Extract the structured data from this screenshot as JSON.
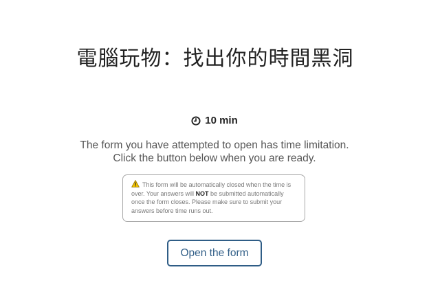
{
  "form": {
    "title": "電腦玩物：找出你的時間黑洞",
    "duration": "10 min",
    "message_line1": "The form you have attempted to open has time limitation.",
    "message_line2": "Click the button below when you are ready.",
    "warning": {
      "icon": "warning-triangle-icon",
      "text_before": "This form will be automatically closed when the time is over. Your answers will ",
      "emphasis": "NOT",
      "text_after": " be submitted automatically once the form closes. Please make sure to submit your answers before time runs out."
    },
    "open_button_label": "Open the form"
  },
  "colors": {
    "button_accent": "#2f5d86",
    "warning_yellow": "#f2c200",
    "text": "#555555"
  }
}
